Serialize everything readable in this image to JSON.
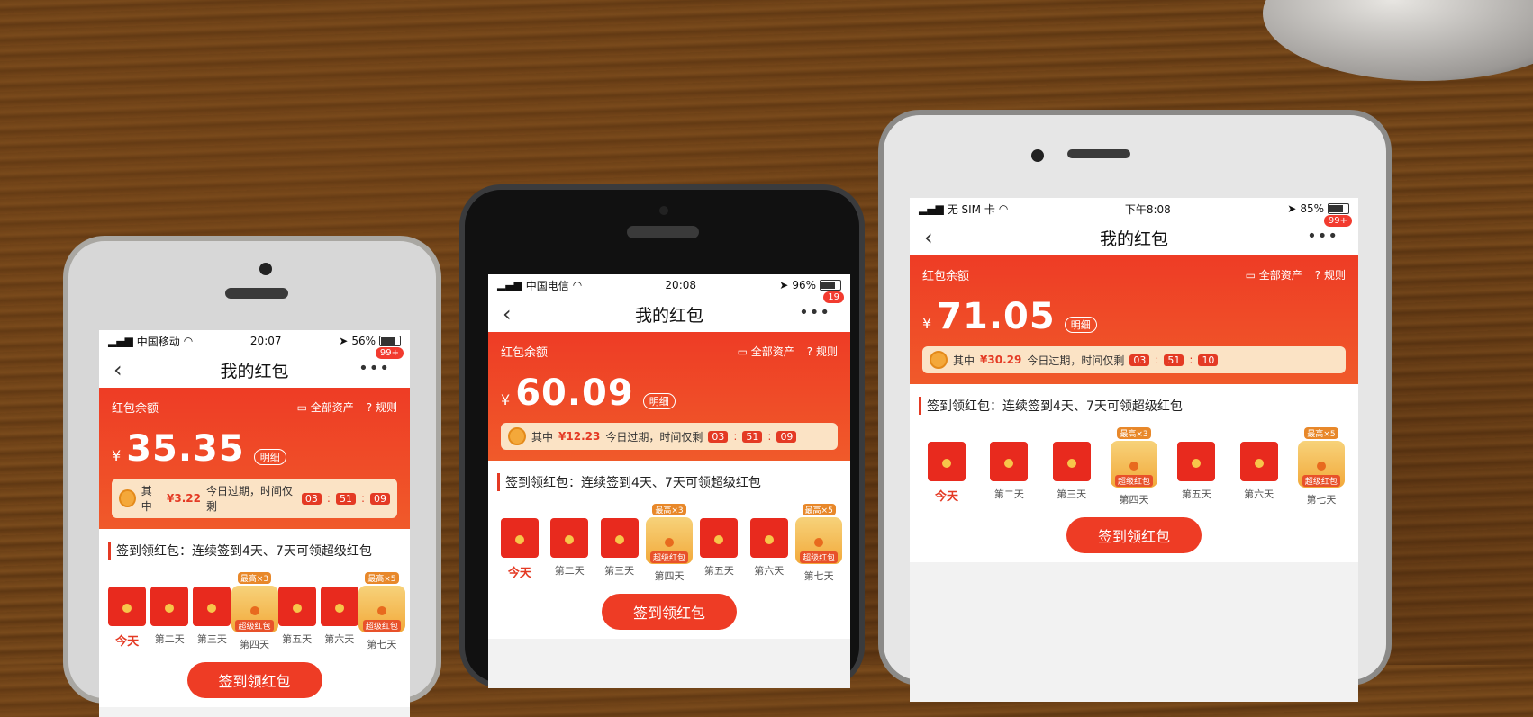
{
  "phones": [
    {
      "status": {
        "carrier": "中国移动",
        "time": "20:07",
        "battery": "56%"
      },
      "nav": {
        "title": "我的红包",
        "badge": "99+"
      },
      "card": {
        "balance_label": "红包余额",
        "all_assets": "全部资产",
        "rules": "规则",
        "yen": "¥",
        "amount": "35.35",
        "detail": "明细",
        "expire_prefix": "其中",
        "expire_amount": "¥3.22",
        "expire_text": "今日过期，时间仅剩",
        "t1": "03",
        "t2": "51",
        "t3": "09"
      },
      "sign": {
        "title": "签到领红包：连续签到4天、7天可领超级红包",
        "top4": "最高×3",
        "top7": "最高×5",
        "super": "超级红包",
        "days": [
          "今天",
          "第二天",
          "第三天",
          "第四天",
          "第五天",
          "第六天",
          "第七天"
        ],
        "button": "签到领红包"
      }
    },
    {
      "status": {
        "carrier": "中国电信",
        "time": "20:08",
        "battery": "96%"
      },
      "nav": {
        "title": "我的红包",
        "badge": "19"
      },
      "card": {
        "balance_label": "红包余额",
        "all_assets": "全部资产",
        "rules": "规则",
        "yen": "¥",
        "amount": "60.09",
        "detail": "明细",
        "expire_prefix": "其中",
        "expire_amount": "¥12.23",
        "expire_text": "今日过期，时间仅剩",
        "t1": "03",
        "t2": "51",
        "t3": "09"
      },
      "sign": {
        "title": "签到领红包：连续签到4天、7天可领超级红包",
        "top4": "最高×3",
        "top7": "最高×5",
        "super": "超级红包",
        "days": [
          "今天",
          "第二天",
          "第三天",
          "第四天",
          "第五天",
          "第六天",
          "第七天"
        ],
        "button": "签到领红包"
      }
    },
    {
      "status": {
        "carrier": "无 SIM 卡",
        "time": "下午8:08",
        "battery": "85%"
      },
      "nav": {
        "title": "我的红包",
        "badge": "99+"
      },
      "card": {
        "balance_label": "红包余额",
        "all_assets": "全部资产",
        "rules": "规则",
        "yen": "¥",
        "amount": "71.05",
        "detail": "明细",
        "expire_prefix": "其中",
        "expire_amount": "¥30.29",
        "expire_text": "今日过期，时间仅剩",
        "t1": "03",
        "t2": "51",
        "t3": "10"
      },
      "sign": {
        "title": "签到领红包：连续签到4天、7天可领超级红包",
        "top4": "最高×3",
        "top7": "最高×5",
        "super": "超级红包",
        "days": [
          "今天",
          "第二天",
          "第三天",
          "第四天",
          "第五天",
          "第六天",
          "第七天"
        ],
        "button": "签到领红包"
      }
    }
  ]
}
